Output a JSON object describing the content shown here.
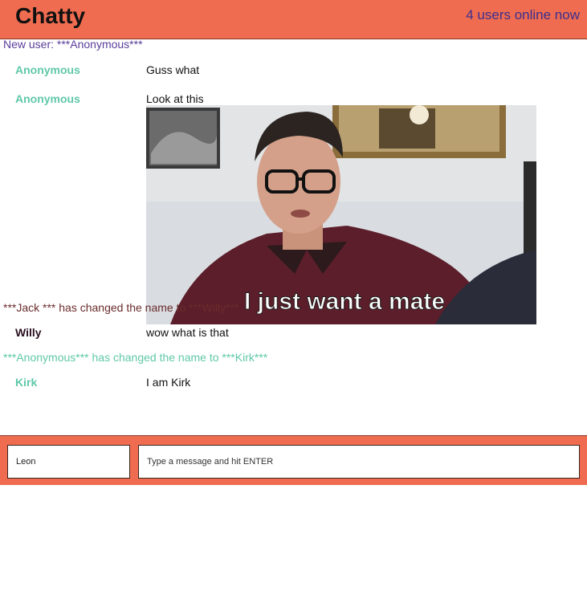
{
  "app": {
    "title": "Chatty",
    "users_online": "4 users online now"
  },
  "colors": {
    "brand": "#ef6c50",
    "system_purple": "#5a3d9a",
    "system_brown": "#6b2c2c",
    "system_teal": "#5fc8a8",
    "username_teal": "#5fc8a8",
    "username_dark": "#2a1020"
  },
  "messages": [
    {
      "kind": "system",
      "text": "New user: ***Anonymous***"
    },
    {
      "kind": "chat",
      "username": "Anonymous",
      "content": "Guss what"
    },
    {
      "kind": "chat",
      "username": "Anonymous",
      "content": "Look at this"
    },
    {
      "kind": "image",
      "caption": "I just want a mate"
    },
    {
      "kind": "system",
      "text": "***Jack *** has changed the name to ***Willy***"
    },
    {
      "kind": "chat",
      "username": "Willy",
      "content": "wow what is that"
    },
    {
      "kind": "system",
      "text": "***Anonymous*** has changed the name to ***Kirk***"
    },
    {
      "kind": "chat",
      "username": "Kirk",
      "content": "I am Kirk"
    }
  ],
  "composer": {
    "username_value": "Leon",
    "message_placeholder": "Type a message and hit ENTER"
  }
}
